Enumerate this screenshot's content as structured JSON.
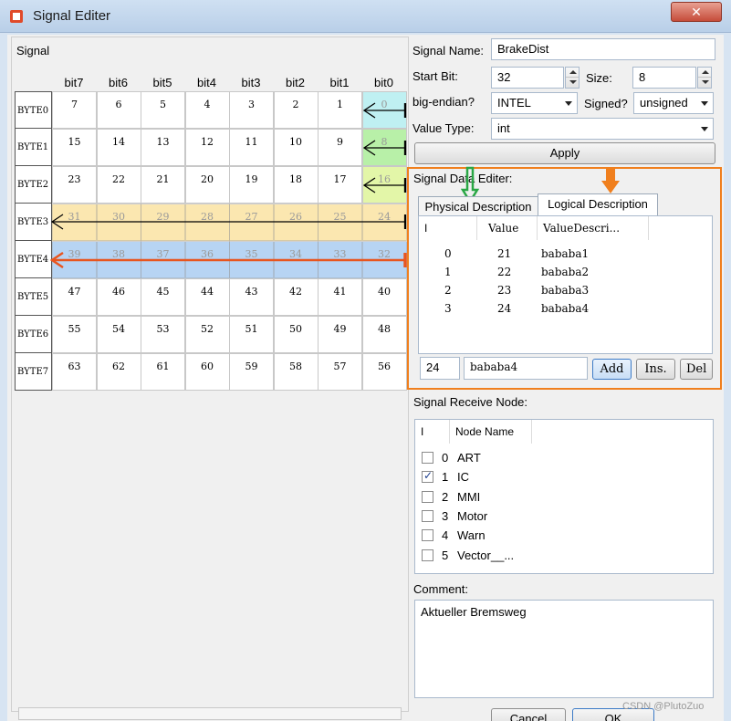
{
  "window": {
    "title": "Signal Editer",
    "close_label": "✕"
  },
  "signal_panel": {
    "label": "Signal",
    "bit_headers": [
      "bit7",
      "bit6",
      "bit5",
      "bit4",
      "bit3",
      "bit2",
      "bit1",
      "bit0"
    ],
    "byte_labels": [
      "BYTE0",
      "BYTE1",
      "BYTE2",
      "BYTE3",
      "BYTE4",
      "BYTE5",
      "BYTE6",
      "BYTE7"
    ],
    "rows": [
      [
        "7",
        "6",
        "5",
        "4",
        "3",
        "2",
        "1",
        "0"
      ],
      [
        "15",
        "14",
        "13",
        "12",
        "11",
        "10",
        "9",
        "8"
      ],
      [
        "23",
        "22",
        "21",
        "20",
        "19",
        "18",
        "17",
        "16"
      ],
      [
        "31",
        "30",
        "29",
        "28",
        "27",
        "26",
        "25",
        "24"
      ],
      [
        "39",
        "38",
        "37",
        "36",
        "35",
        "34",
        "33",
        "32"
      ],
      [
        "47",
        "46",
        "45",
        "44",
        "43",
        "42",
        "41",
        "40"
      ],
      [
        "55",
        "54",
        "53",
        "52",
        "51",
        "50",
        "49",
        "48"
      ],
      [
        "63",
        "62",
        "61",
        "60",
        "59",
        "58",
        "57",
        "56"
      ]
    ],
    "colors": {
      "cyan": "#bff0f2",
      "green": "#b8f0a8",
      "yellow_green": "#e3f6a8",
      "orange_row": "#fbe7b0",
      "blue_row": "#b7d4f3",
      "black_arrow": "#000000",
      "orange_arrow": "#e8551f"
    }
  },
  "props": {
    "signal_name_label": "Signal Name:",
    "signal_name": "BrakeDist",
    "start_bit_label": "Start Bit:",
    "start_bit": "32",
    "size_label": "Size:",
    "size": "8",
    "endian_label": "big-endian?",
    "endian": "INTEL",
    "signed_label": "Signed?",
    "signed": "unsigned",
    "value_type_label": "Value Type:",
    "value_type": "int",
    "apply_label": "Apply"
  },
  "data_editor": {
    "label": "Signal Data Editer:",
    "tabs": [
      "Physical Description",
      "Logical  Description"
    ],
    "columns": [
      "I",
      "Value",
      "ValueDescri..."
    ],
    "rows": [
      {
        "i": "0",
        "value": "21",
        "desc": "bababa1"
      },
      {
        "i": "1",
        "value": "22",
        "desc": "bababa2"
      },
      {
        "i": "2",
        "value": "23",
        "desc": "bababa3"
      },
      {
        "i": "3",
        "value": "24",
        "desc": "bababa4"
      }
    ],
    "value_input": "24",
    "desc_input": "bababa4",
    "add_label": "Add",
    "ins_label": "Ins.",
    "del_label": "Del",
    "green_arrow_color": "#2aa745",
    "orange_arrow_color": "#f07f1d"
  },
  "receive": {
    "label": "Signal Receive Node:",
    "columns": [
      "I",
      "Node Name"
    ],
    "nodes": [
      {
        "i": "0",
        "name": "ART",
        "checked": false
      },
      {
        "i": "1",
        "name": "IC",
        "checked": true
      },
      {
        "i": "2",
        "name": "MMI",
        "checked": false
      },
      {
        "i": "3",
        "name": "Motor",
        "checked": false
      },
      {
        "i": "4",
        "name": "Warn",
        "checked": false
      },
      {
        "i": "5",
        "name": "Vector__...",
        "checked": false
      }
    ]
  },
  "comment": {
    "label": "Comment:",
    "text": "Aktueller Bremsweg"
  },
  "footer": {
    "cancel_label": "Cancel",
    "ok_label": "OK",
    "watermark": "CSDN @PlutoZuo"
  }
}
